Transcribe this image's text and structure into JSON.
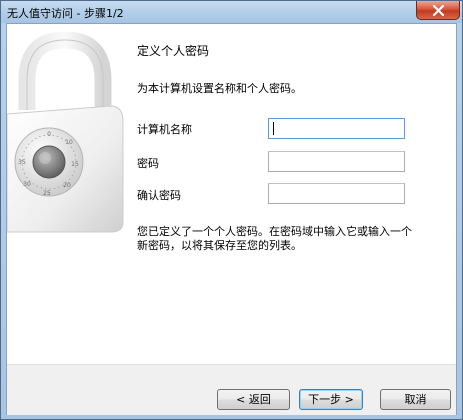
{
  "window": {
    "title": "无人值守访问 - 步骤1/2"
  },
  "content": {
    "heading": "定义个人密码",
    "description": "为本计算机设置名称和个人密码。",
    "fields": {
      "computer_name_label": "计算机名称",
      "computer_name_value": "",
      "password_label": "密码",
      "password_value": "",
      "confirm_label": "确认密码",
      "confirm_value": ""
    },
    "note": "您已定义了一个个人密码。在密码域中输入它或输入一个新密码，以将其保存至您的列表。"
  },
  "buttons": {
    "back": "< 返回",
    "next": "下一步 >",
    "cancel": "取消"
  },
  "icons": {
    "lock": "padlock-icon",
    "close": "close-icon"
  },
  "colors": {
    "title_bar": "#b1cde8",
    "close_button": "#c33a1f",
    "focus_border": "#569de5"
  }
}
